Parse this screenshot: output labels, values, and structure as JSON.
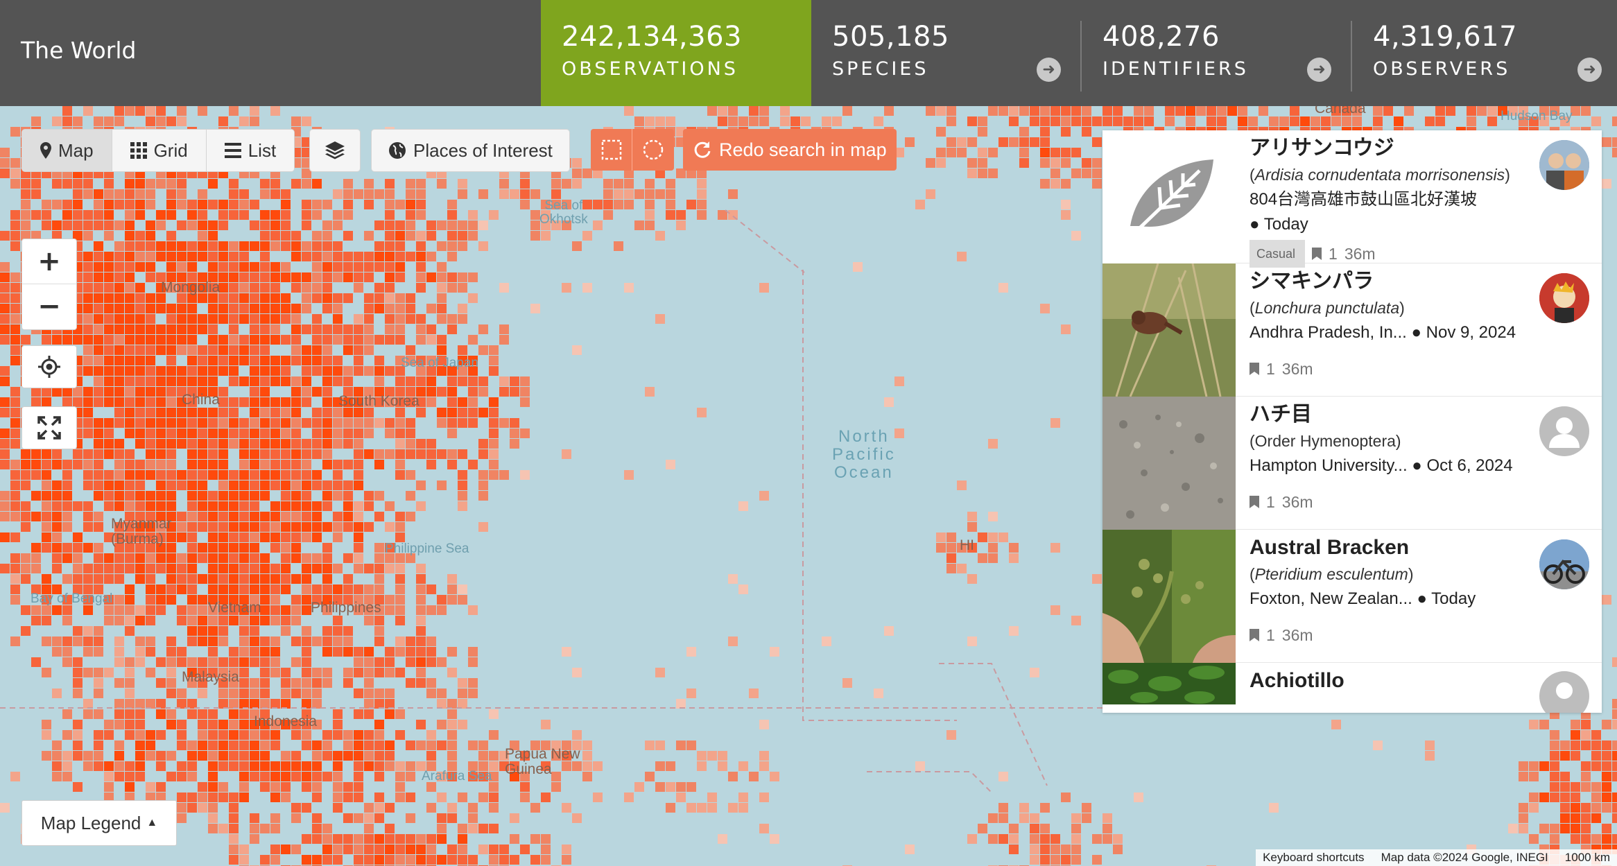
{
  "place_title": "The World",
  "stats": [
    {
      "number": "242,134,363",
      "label": "OBSERVATIONS"
    },
    {
      "number": "505,185",
      "label": "SPECIES"
    },
    {
      "number": "408,276",
      "label": "IDENTIFIERS"
    },
    {
      "number": "4,319,617",
      "label": "OBSERVERS"
    }
  ],
  "toolbar": {
    "map": "Map",
    "grid": "Grid",
    "list": "List",
    "places": "Places of Interest",
    "redo": "Redo search in map"
  },
  "map_labels": {
    "mongolia": "Mongolia",
    "china": "China",
    "south_korea": "South Korea",
    "sea_of_okhotsk": "Sea of\nOkhotsk",
    "sea_of_japan": "Sea of Japan",
    "philippine_sea": "Philippine Sea",
    "bay_of_bengal": "Bay of Bengal",
    "myanmar": "Myanmar\n(Burma)",
    "vietnam": "Vietnam",
    "philippines": "Philippines",
    "malaysia": "Malaysia",
    "indonesia": "Indonesia",
    "papua": "Papua New\nGuinea",
    "arafura": "Arafura Sea",
    "north_pacific": "North\nPacific\nOcean",
    "hudson_bay": "Hudson Bay",
    "canada": "Canada",
    "hi": "HI"
  },
  "legend_label": "Map Legend",
  "attribution": {
    "shortcuts": "Keyboard shortcuts",
    "mapdata": "Map data ©2024 Google, INEGI",
    "scale": "1000 km"
  },
  "observations": [
    {
      "title": "アリサンコウジ",
      "sci_prefix": "(",
      "sci": "Ardisia cornudentata morrisonensis",
      "sci_suffix": ")",
      "place": "804台灣高雄市鼓山區北好漢坡",
      "date": "● Today",
      "badge": "Casual",
      "ids": "1",
      "time": "36m"
    },
    {
      "title": "シマキンパラ",
      "sci_prefix": "(",
      "sci": "Lonchura punctulata",
      "sci_suffix": ")",
      "place": "Andhra Pradesh, In...",
      "date": "● Nov 9, 2024",
      "badge": "",
      "ids": "1",
      "time": "36m"
    },
    {
      "title": "ハチ目",
      "sci_prefix": "(Order Hymenoptera)",
      "sci": "",
      "sci_suffix": "",
      "place": "Hampton University...",
      "date": "● Oct 6, 2024",
      "badge": "",
      "ids": "1",
      "time": "36m"
    },
    {
      "title": "Austral Bracken",
      "sci_prefix": "(",
      "sci": "Pteridium esculentum",
      "sci_suffix": ")",
      "place": "Foxton, New Zealan...",
      "date": "● Today",
      "badge": "",
      "ids": "1",
      "time": "36m"
    },
    {
      "title": "Achiotillo",
      "sci_prefix": "",
      "sci": "",
      "sci_suffix": "",
      "place": "",
      "date": "",
      "badge": "",
      "ids": "",
      "time": ""
    }
  ],
  "colors": {
    "heat_dark": "#ff4a0c",
    "heat_light": "#f6b9a3",
    "active_stat": "#7fa51e",
    "orange": "#f07a55"
  }
}
